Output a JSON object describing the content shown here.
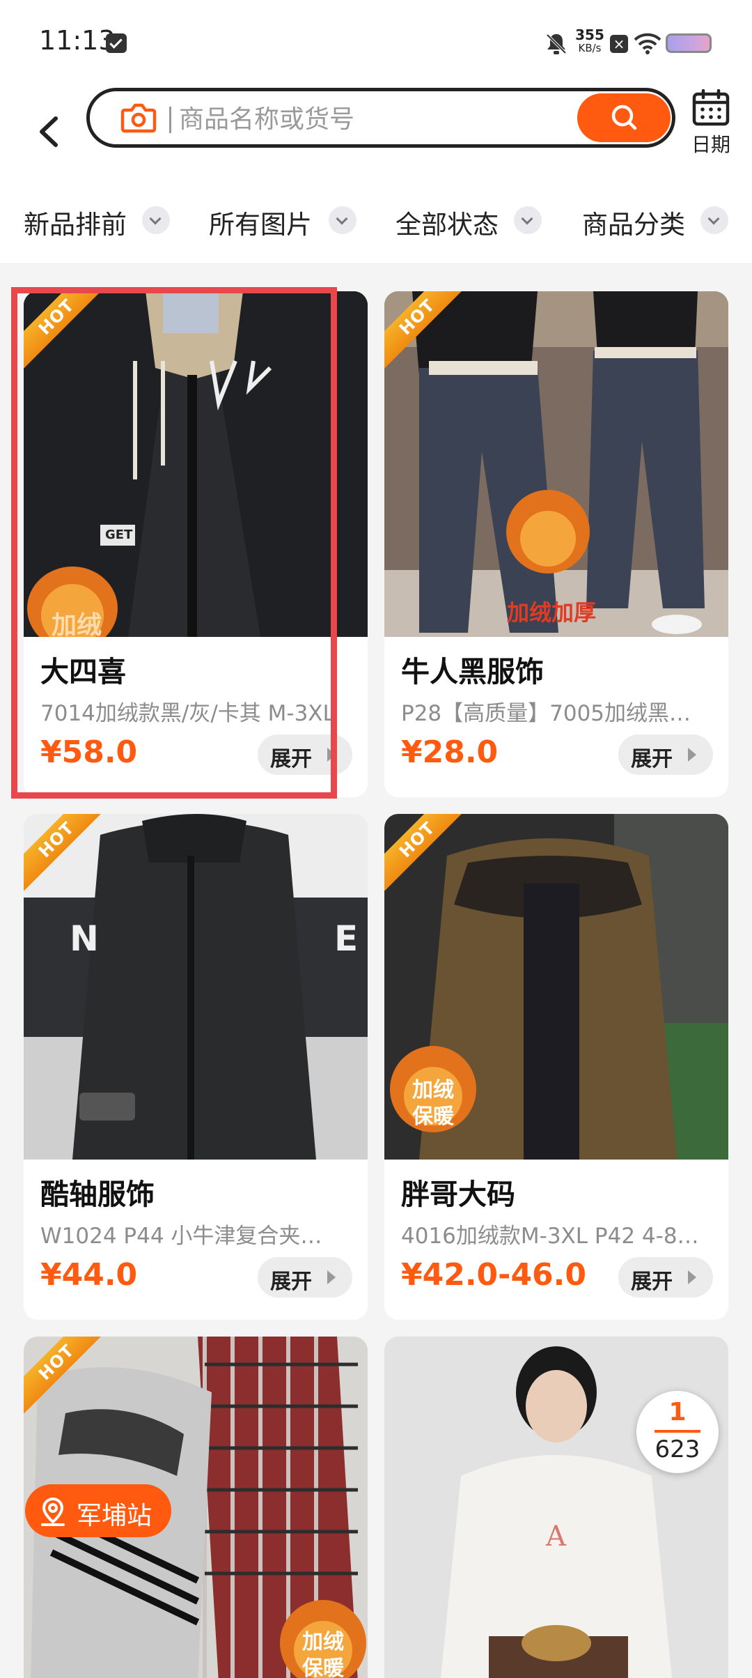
{
  "status_bar": {
    "time": "11:13",
    "net_speed": "355",
    "net_unit": "KB/s",
    "icons": [
      "message-icon",
      "bell-off-icon",
      "close-box-icon",
      "wifi-icon",
      "battery-icon"
    ]
  },
  "search": {
    "placeholder": "商品名称或货号",
    "camera_icon": "camera-icon",
    "search_icon": "search-icon"
  },
  "date_button": {
    "label": "日期",
    "icon": "calendar-icon"
  },
  "filters": [
    {
      "label": "新品排前"
    },
    {
      "label": "所有图片"
    },
    {
      "label": "全部状态"
    },
    {
      "label": "商品分类"
    }
  ],
  "products": [
    {
      "badge": "HOT",
      "title": "大四喜",
      "subtitle": "7014加绒款黑/灰/卡其 M-3XL",
      "price": "¥58.0",
      "action": "展开"
    },
    {
      "badge": "HOT",
      "title": "牛人黑服饰",
      "subtitle": "P28【高质量】7005加绒黑…",
      "price": "¥28.0",
      "action": "展开"
    },
    {
      "badge": "HOT",
      "title": "酷轴服饰",
      "subtitle": "W1024 P44 小牛津复合夹…",
      "price": "¥44.0",
      "action": "展开"
    },
    {
      "badge": "HOT",
      "title": "胖哥大码",
      "subtitle": "4016加绒款M-3XL P42 4-8…",
      "price": "¥42.0-46.0",
      "action": "展开"
    },
    {
      "badge": "HOT"
    },
    {}
  ],
  "location_pill": {
    "label": "军埔站",
    "icon": "location-pin-icon"
  },
  "page_counter": {
    "current": "1",
    "total": "623"
  },
  "image_text": {
    "p1_flame": "加绒",
    "p1_tag": "GET",
    "p2_flame": "加绒加厚",
    "p3_wall": "N",
    "p3_wall2": "E",
    "p4_flame": "加绒保暖",
    "p5_flame": "加绒保暖"
  },
  "colors": {
    "accent": "#ff5a10",
    "hot_badge": "#f5a623",
    "selection": "#e8474c",
    "price": "#ff5a10"
  }
}
